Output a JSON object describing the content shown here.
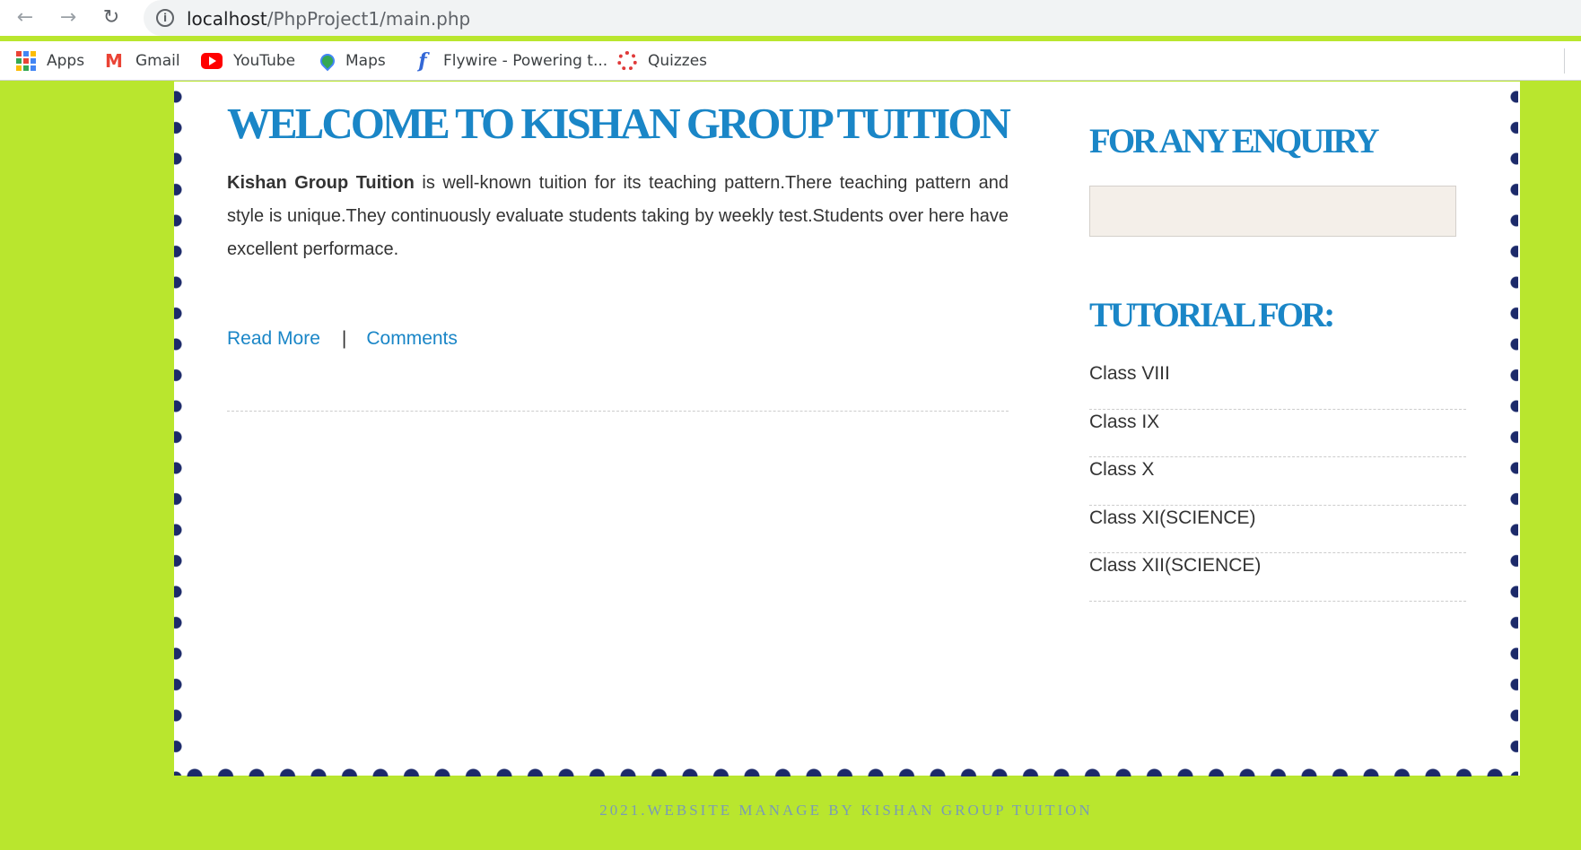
{
  "browser": {
    "url_host": "localhost",
    "url_path": "/PhpProject1/main.php",
    "bookmarks": [
      {
        "label": "Apps",
        "icon": "apps-grid-icon"
      },
      {
        "label": "Gmail",
        "icon": "gmail-icon"
      },
      {
        "label": "YouTube",
        "icon": "youtube-icon"
      },
      {
        "label": "Maps",
        "icon": "maps-icon"
      },
      {
        "label": "Flywire - Powering t...",
        "icon": "flywire-icon"
      },
      {
        "label": "Quizzes",
        "icon": "quizzes-icon"
      }
    ]
  },
  "main": {
    "title": "WELCOME TO KISHAN GROUP TUITION",
    "intro_bold": "Kishan Group Tuition",
    "intro_text": " is well-known tuition for its teaching pattern.There teaching pattern and style is unique.They continuously evaluate students taking by weekly test.Students over here have excellent performace.",
    "read_more": "Read More",
    "separator": "|",
    "comments": "Comments"
  },
  "sidebar": {
    "enquiry_title": "FOR ANY ENQUIRY",
    "tutorial_title": "TUTORIAL FOR:",
    "classes": [
      "Class VIII",
      "Class IX",
      "Class X",
      "Class XI(SCIENCE)",
      "Class XII(SCIENCE)"
    ]
  },
  "footer": {
    "text": "2021.WEBSITE MANAGE BY KISHAN GROUP TUITION"
  },
  "colors": {
    "page_bg": "#b9e62e",
    "accent_blue": "#1a86c7",
    "dot_border": "#1c2a6a"
  }
}
